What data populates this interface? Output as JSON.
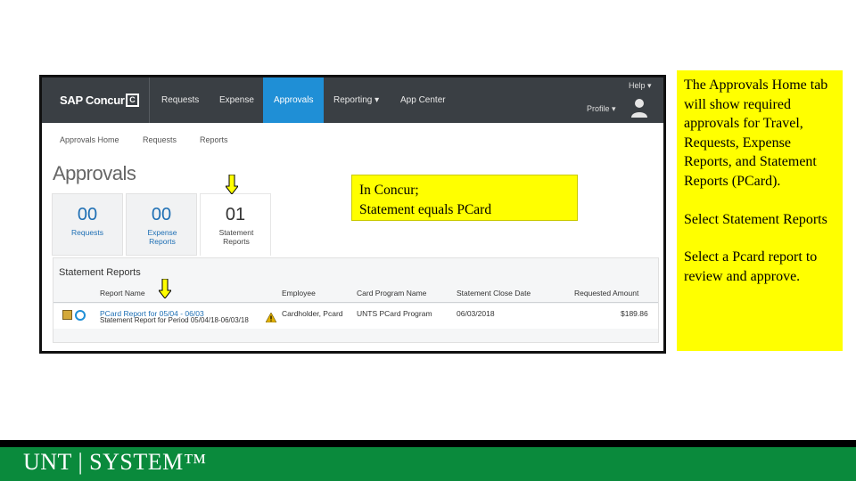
{
  "app": {
    "logo_text": "SAP Concur",
    "logo_mark": "C",
    "nav": {
      "requests": "Requests",
      "expense": "Expense",
      "approvals": "Approvals",
      "reporting": "Reporting ▾",
      "app_center": "App Center"
    },
    "help": "Help ▾",
    "profile": "Profile ▾",
    "subnav": {
      "approvals_home": "Approvals Home",
      "requests": "Requests",
      "reports": "Reports"
    },
    "page_title": "Approvals",
    "tiles": [
      {
        "count": "00",
        "label": "Requests"
      },
      {
        "count": "00",
        "label": "Expense Reports"
      },
      {
        "count": "01",
        "label": "Statement Reports"
      }
    ],
    "statement_reports": {
      "title": "Statement Reports",
      "columns": {
        "report_name": "Report Name",
        "employee": "Employee",
        "card_program": "Card Program Name",
        "close_date": "Statement Close Date",
        "amount": "Requested Amount"
      },
      "row": {
        "report_name": "PCard Report for 05/04 - 06/03",
        "report_sub": "Statement Report for Period 05/04/18-06/03/18",
        "employee": "Cardholder, Pcard",
        "card_program": "UNTS PCard Program",
        "close_date": "06/03/2018",
        "amount": "$189.86"
      }
    }
  },
  "callouts": {
    "pcard_line1": "In Concur;",
    "pcard_line2": "Statement equals PCard",
    "side_p1": "The Approvals Home tab will show required approvals for Travel, Requests, Expense Reports, and Statement Reports (PCard).",
    "side_p2": "Select Statement Reports",
    "side_p3": "Select a Pcard report to review and approve."
  },
  "footer": {
    "logo": "UNT | SYSTEM™"
  },
  "colors": {
    "nav_bg": "#3a3f44",
    "active_tab": "#1f8fd6",
    "highlight": "#ffff00",
    "footer_green": "#0a8a3c"
  }
}
